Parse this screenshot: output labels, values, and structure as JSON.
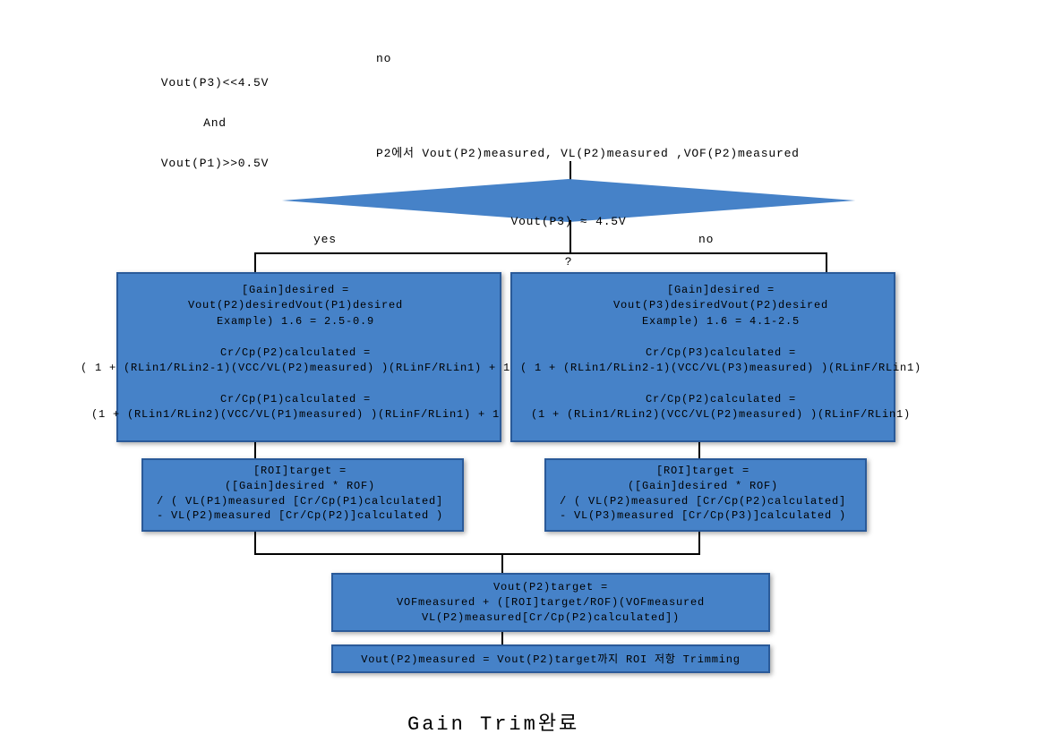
{
  "top_condition": {
    "line1": "Vout(P3)<<4.5V",
    "line2": "And",
    "line3": "Vout(P1)>>0.5V"
  },
  "top_no": "no",
  "measure_row": "P2에서 Vout(P2)measured, VL(P2)measured ,VOF(P2)measured",
  "decision": {
    "line1": "Vout(P3) ≈ 4.5V",
    "line2": "?"
  },
  "branch_yes": "yes",
  "branch_no": "no",
  "left": {
    "gain_block": "[Gain]desired =\nVout(P2)desiredVout(P1)desired\nExample) 1.6 = 2.5-0.9\n\nCr/Cp(P2)calculated =\n( 1 + (RLin1/RLin2-1)(VCC/VL(P2)measured) )(RLinF/RLin1) + 1\n\nCr/Cp(P1)calculated =\n(1 + (RLin1/RLin2)(VCC/VL(P1)measured) )(RLinF/RLin1) + 1",
    "roi_block": "[ROI]target =\n([Gain]desired * ROF)\n/ ( VL(P1)measured [Cr/Cp(P1)calculated]\n- VL(P2)measured [Cr/Cp(P2)]calculated )"
  },
  "right": {
    "gain_block": "[Gain]desired =\nVout(P3)desiredVout(P2)desired\nExample) 1.6 = 4.1-2.5\n\nCr/Cp(P3)calculated =\n( 1 + (RLin1/RLin2-1)(VCC/VL(P3)measured) )(RLinF/RLin1)\n\nCr/Cp(P2)calculated =\n(1 + (RLin1/RLin2)(VCC/VL(P2)measured) )(RLinF/RLin1)",
    "roi_block": "[ROI]target =\n([Gain]desired * ROF)\n/ ( VL(P2)measured [Cr/Cp(P2)calculated]\n- VL(P3)measured [Cr/Cp(P3)]calculated )"
  },
  "target_block": "Vout(P2)target =\nVOFmeasured + ([ROI]target/ROF)(VOFmeasured\nVL(P2)measured[Cr/Cp(P2)calculated])",
  "trim_block": "Vout(P2)measured = Vout(P2)target까지 ROI 저항 Trimming",
  "title": "Gain Trim완료"
}
